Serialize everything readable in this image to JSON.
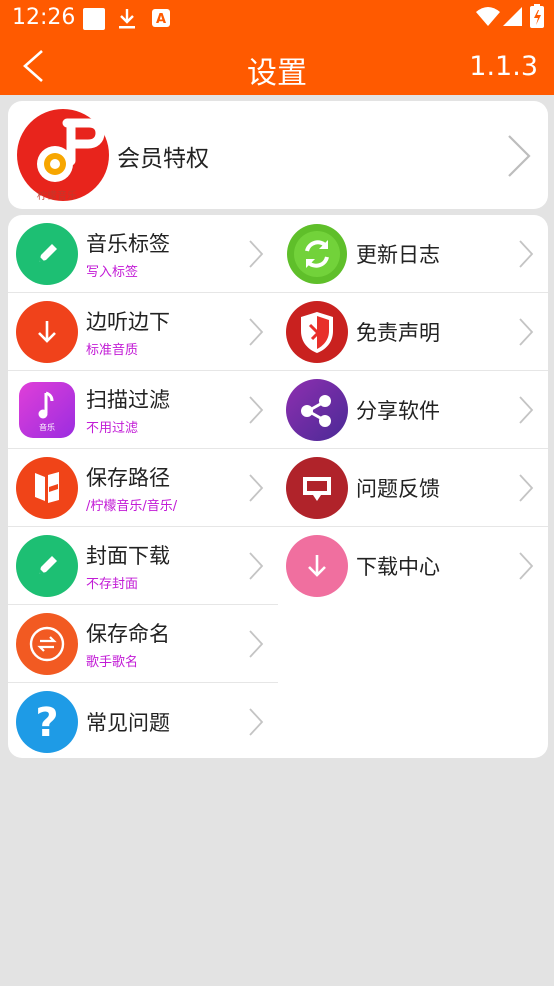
{
  "status_bar": {
    "time": "12:26"
  },
  "header": {
    "title": "设置",
    "version": "1.1.3"
  },
  "vip": {
    "label": "会员特权",
    "logo_text": "柠檬音乐"
  },
  "menu": {
    "left": [
      {
        "label": "音乐标签",
        "sub": "写入标签",
        "icon": "pencil-icon"
      },
      {
        "label": "边听边下",
        "sub": "标准音质",
        "icon": "download-icon"
      },
      {
        "label": "扫描过滤",
        "sub": "不用过滤",
        "icon": "music-app-icon"
      },
      {
        "label": "保存路径",
        "sub": "/柠檬音乐/音乐/",
        "icon": "bookmark-icon"
      },
      {
        "label": "封面下载",
        "sub": "不存封面",
        "icon": "pencil-icon"
      },
      {
        "label": "保存命名",
        "sub": "歌手歌名",
        "icon": "swap-icon"
      },
      {
        "label": "常见问题",
        "icon": "question-icon"
      }
    ],
    "right": [
      {
        "label": "更新日志",
        "icon": "refresh-icon"
      },
      {
        "label": "免责声明",
        "icon": "shield-icon"
      },
      {
        "label": "分享软件",
        "icon": "share-icon"
      },
      {
        "label": "问题反馈",
        "icon": "feedback-icon"
      },
      {
        "label": "下载中心",
        "icon": "download-icon"
      }
    ]
  },
  "colors": {
    "accent": "#ff5a00",
    "subtext": "#c21bd6",
    "green": "#1dbf73",
    "red": "#f0421b",
    "pink": "#f06f9f",
    "purple": "#6a2ea5",
    "dark_red": "#b0232a",
    "blue": "#1e9be6"
  }
}
